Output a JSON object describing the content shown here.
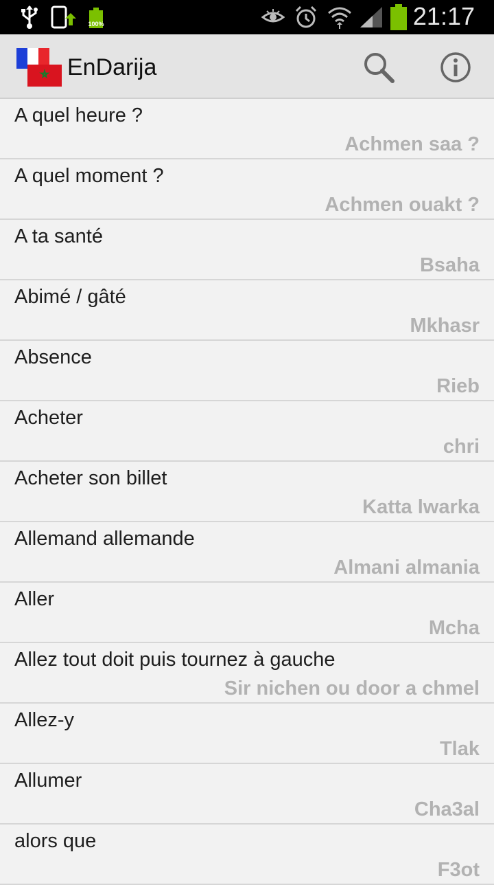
{
  "status_bar": {
    "icons": [
      "usb-icon",
      "screenshot-upload-icon",
      "battery-full-small-icon",
      "eye-icon",
      "alarm-icon",
      "wifi-icon",
      "signal-icon",
      "battery-icon"
    ],
    "small_battery_label": "100%",
    "time": "21:17"
  },
  "action_bar": {
    "title": "EnDarija",
    "search_icon": "search-icon",
    "info_icon": "info-icon"
  },
  "colors": {
    "action_bar_bg": "#e4e4e4",
    "list_bg": "#f2f2f2",
    "translation_text": "#b2b2b2",
    "battery_green": "#7bc000"
  },
  "entries": [
    {
      "fr": "A quel heure ?",
      "dr": "Achmen saa ?"
    },
    {
      "fr": "A quel moment ?",
      "dr": "Achmen ouakt ?"
    },
    {
      "fr": "A ta santé",
      "dr": "Bsaha"
    },
    {
      "fr": "Abimé / gâté",
      "dr": "Mkhasr"
    },
    {
      "fr": "Absence",
      "dr": "Rieb"
    },
    {
      "fr": "Acheter",
      "dr": "chri"
    },
    {
      "fr": "Acheter son billet",
      "dr": "Katta lwarka"
    },
    {
      "fr": "Allemand allemande",
      "dr": "Almani almania"
    },
    {
      "fr": "Aller",
      "dr": "Mcha"
    },
    {
      "fr": "Allez tout doit puis tournez à gauche",
      "dr": "Sir nichen ou door a chmel"
    },
    {
      "fr": "Allez-y",
      "dr": "Tlak"
    },
    {
      "fr": "Allumer",
      "dr": "Cha3al"
    },
    {
      "fr": "alors que",
      "dr": "F3ot"
    }
  ]
}
